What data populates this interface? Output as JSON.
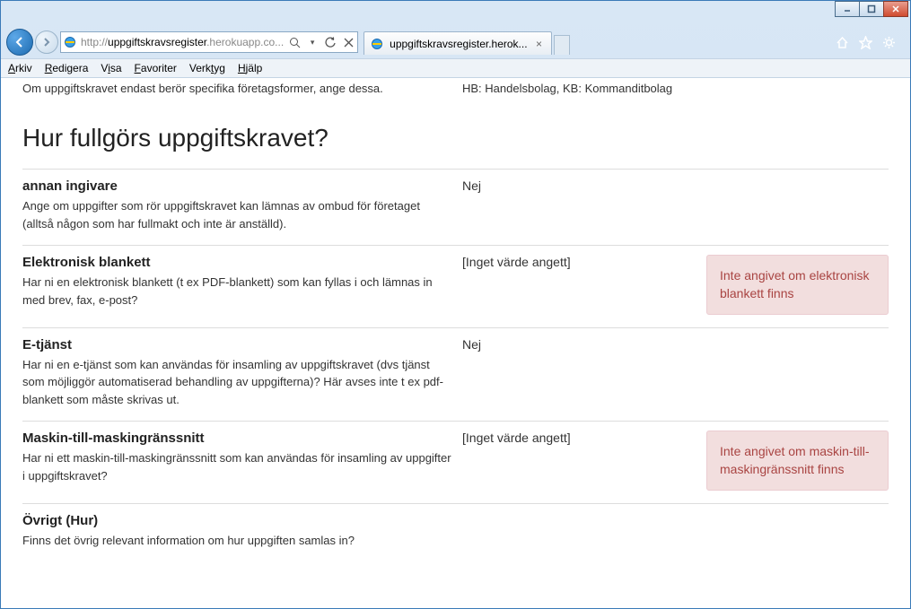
{
  "window": {
    "url_display_prefix": "http://",
    "url_display_host": "uppgiftskravsregister",
    "url_display_rest": ".herokuapp.co...",
    "tab_title": "uppgiftskravsregister.herok..."
  },
  "menubar": {
    "arkiv": "Arkiv",
    "redigera": "Redigera",
    "visa": "Visa",
    "favoriter": "Favoriter",
    "verktyg": "Verktyg",
    "hjalp": "Hjälp"
  },
  "partial_top": {
    "left": "Om uppgiftskravet endast berör specifika företagsformer, ange dessa.",
    "right": "HB: Handelsbolag, KB: Kommanditbolag"
  },
  "section_heading": "Hur fullgörs uppgiftskravet?",
  "rows": [
    {
      "title": "annan ingivare",
      "desc": "Ange om uppgifter som rör uppgiftskravet kan lämnas av ombud för företaget (alltså någon som har fullmakt och inte är anställd).",
      "value": "Nej",
      "alert": ""
    },
    {
      "title": "Elektronisk blankett",
      "desc": "Har ni en elektronisk blankett (t ex PDF-blankett) som kan fyllas i och lämnas in med brev, fax, e-post?",
      "value": "[Inget värde angett]",
      "alert": "Inte angivet om elektronisk blankett finns"
    },
    {
      "title": "E-tjänst",
      "desc": "Har ni en e-tjänst som kan användas för insamling av uppgiftskravet (dvs tjänst som möjliggör automatiserad behandling av uppgifterna)? Här avses inte t ex pdf-blankett som måste skrivas ut.",
      "value": "Nej",
      "alert": ""
    },
    {
      "title": "Maskin-till-maskingränssnitt",
      "desc": "Har ni ett maskin-till-maskingränssnitt som kan användas för insamling av uppgifter i uppgiftskravet?",
      "value": "[Inget värde angett]",
      "alert": "Inte angivet om maskin-till-maskingränssnitt finns"
    },
    {
      "title": "Övrigt (Hur)",
      "desc": "Finns det övrig relevant information om hur uppgiften samlas in?",
      "value": "",
      "alert": ""
    }
  ]
}
